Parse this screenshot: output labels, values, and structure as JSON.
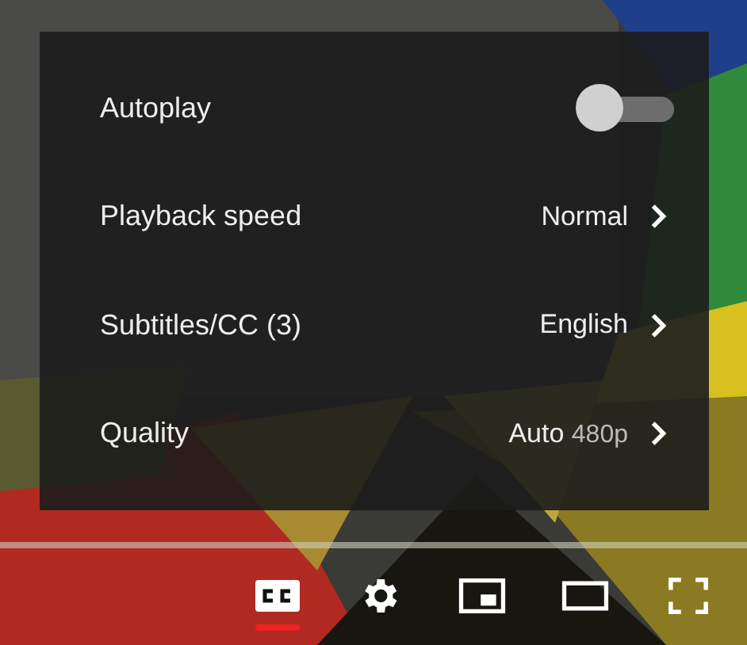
{
  "settings_menu": {
    "items": [
      {
        "kind": "toggle",
        "label": "Autoplay",
        "on": false
      },
      {
        "kind": "submenu",
        "label": "Playback speed",
        "value": "Normal"
      },
      {
        "kind": "submenu",
        "label": "Subtitles/CC (3)",
        "value": "English"
      },
      {
        "kind": "submenu",
        "label": "Quality",
        "value": "Auto",
        "value_detail": "480p"
      }
    ]
  },
  "controls": {
    "captions_on": true
  }
}
